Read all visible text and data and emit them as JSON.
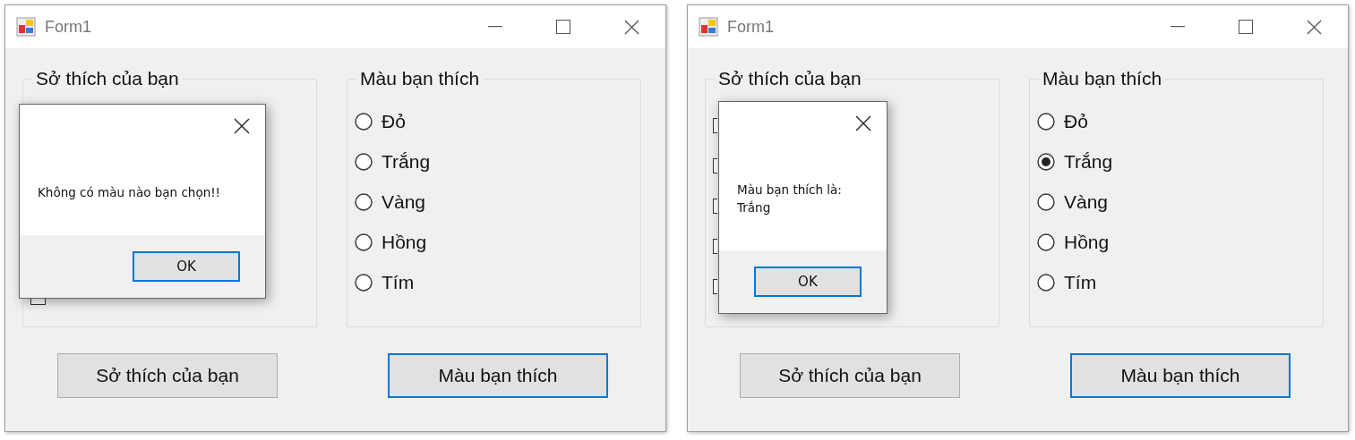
{
  "windows": [
    {
      "title": "Form1",
      "hobbies_group": {
        "title": "Sở thích của bạn",
        "checkboxes": [
          {
            "checked": false
          }
        ]
      },
      "colors_group": {
        "title": "Màu bạn thích",
        "options": [
          {
            "label": "Đỏ",
            "selected": false
          },
          {
            "label": "Trắng",
            "selected": false
          },
          {
            "label": "Vàng",
            "selected": false
          },
          {
            "label": "Hồng",
            "selected": false
          },
          {
            "label": "Tím",
            "selected": false
          }
        ]
      },
      "buttons": [
        {
          "label": "Sở thích của bạn",
          "focused": false
        },
        {
          "label": "Màu bạn thích",
          "focused": true
        }
      ],
      "message_box": {
        "message": "Không có màu nào bạn chọn!!",
        "button": "OK"
      }
    },
    {
      "title": "Form1",
      "hobbies_group": {
        "title": "Sở thích của bạn",
        "checkboxes": [
          {
            "checked": false
          },
          {
            "checked": false
          },
          {
            "checked": false
          },
          {
            "checked": false
          },
          {
            "checked": false
          }
        ]
      },
      "colors_group": {
        "title": "Màu bạn thích",
        "options": [
          {
            "label": "Đỏ",
            "selected": false
          },
          {
            "label": "Trắng",
            "selected": true
          },
          {
            "label": "Vàng",
            "selected": false
          },
          {
            "label": "Hồng",
            "selected": false
          },
          {
            "label": "Tím",
            "selected": false
          }
        ]
      },
      "buttons": [
        {
          "label": "Sở thích của bạn",
          "focused": false
        },
        {
          "label": "Màu bạn thích",
          "focused": true
        }
      ],
      "message_box": {
        "message": "Màu bạn thích là:\nTrắng",
        "button": "OK"
      }
    }
  ]
}
